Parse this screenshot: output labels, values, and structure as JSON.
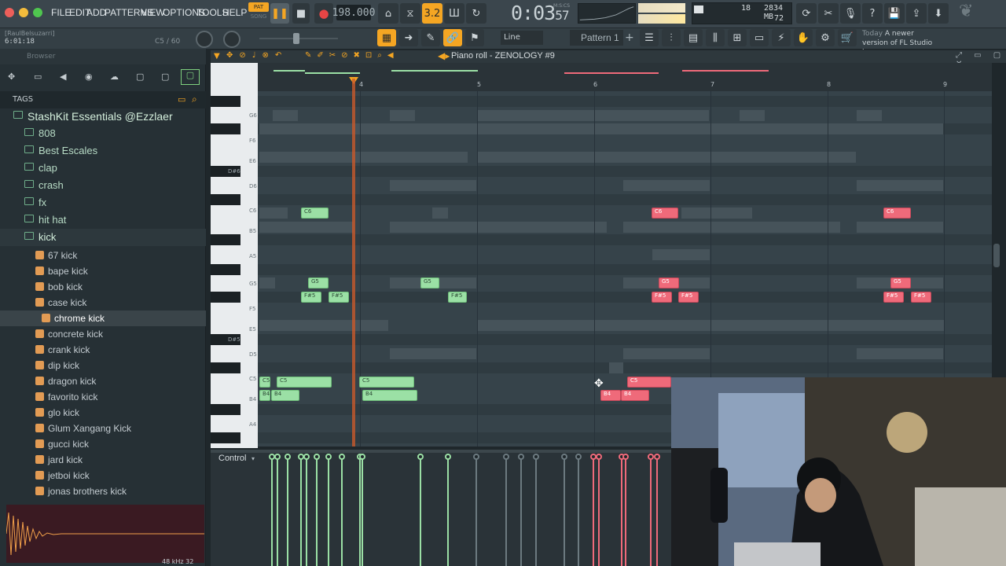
{
  "menu": [
    "FILE",
    "EDIT",
    "ADD",
    "PATTERNS",
    "VIEW",
    "OPTIONS",
    "TOOLS",
    "HELP"
  ],
  "transport": {
    "pat_label": "PAT",
    "song_label": "SONG",
    "tempo": "198.000",
    "time": "0:03",
    "time_ms": "57",
    "time_format": "M:S:CS"
  },
  "status": {
    "cpu_value": "18",
    "memory": "2834 MB",
    "poly": "72"
  },
  "hint": {
    "user": "[RaulBelsuzarri]",
    "position": "6:01:18",
    "counter": "C5 / 60"
  },
  "toolbar2": {
    "snap": "Line",
    "pattern": "Pattern 1",
    "news_date": "Today",
    "news_text": "A newer version of FL Studio i..."
  },
  "browser": {
    "header": "Browser",
    "tags_label": "TAGS",
    "root_folder": "StashKit Essentials @Ezzlaer",
    "folders": [
      "808",
      "Best Escales",
      "clap",
      "crash",
      "fx",
      "hit hat",
      "kick"
    ],
    "files": [
      "67 kick",
      "bape kick",
      "bob kick",
      "case kick",
      "chrome kick",
      "concrete kick",
      "crank kick",
      "dip kick",
      "dragon kick",
      "favorito kick",
      "glo kick",
      "Glum Xangang Kick",
      "gucci kick",
      "jard kick",
      "jetboi kick",
      "jonas brothers kick"
    ],
    "selected_file": "chrome kick",
    "sample_info": "48 kHz 32"
  },
  "piano_roll": {
    "title": "Piano roll - ZENOLOGY #9",
    "bars": [
      "4",
      "5",
      "6",
      "7",
      "8",
      "9"
    ],
    "key_labels": [
      "G6",
      "F6",
      "E6",
      "D6",
      "C6",
      "B5",
      "A5",
      "G5",
      "F5",
      "E5",
      "D5",
      "C5",
      "B4",
      "A4"
    ],
    "black_key_labels": [
      "D#6",
      "D#5"
    ],
    "notes_green": [
      "C6",
      "G5",
      "F#5",
      "F#5",
      "G5",
      "F#5",
      "C5",
      "C5",
      "C5",
      "B4",
      "B4",
      "B4"
    ],
    "notes_red": [
      "C6",
      "G5",
      "F#5",
      "F#5",
      "C6",
      "G5",
      "F#5",
      "F#5",
      "C5",
      "B4",
      "B4"
    ],
    "control_label": "Control"
  },
  "colors": {
    "note_green": "#9be0a5",
    "note_red": "#ef6a7a",
    "playhead": "#c95a2a",
    "accent": "#f5a623"
  }
}
